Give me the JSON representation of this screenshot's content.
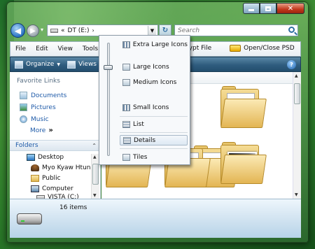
{
  "toolbar_nav": {
    "address_prefix": "«",
    "address_text": "DT (E:)",
    "address_sep": "›",
    "search_placeholder": "Search"
  },
  "menubar": {
    "items": [
      "File",
      "Edit",
      "View",
      "Tools"
    ],
    "encrypt_label": "crypt File",
    "open_close_label": "Open/Close PSD"
  },
  "commandbar": {
    "organize_label": "Organize",
    "views_label": "Views"
  },
  "favorites": {
    "header": "Favorite Links",
    "items": [
      "Documents",
      "Pictures",
      "Music"
    ],
    "more_label": "More",
    "more_chevron": "»"
  },
  "folders": {
    "header": "Folders",
    "tree": [
      "Desktop",
      "Myo Kyaw Htun",
      "Public",
      "Computer",
      "VISTA (C:)"
    ]
  },
  "views_menu": {
    "items": [
      {
        "label": "Extra Large Icons",
        "icon": "grid"
      },
      {
        "label": "Large Icons",
        "icon": "icon"
      },
      {
        "label": "Medium Icons",
        "icon": "icon"
      },
      {
        "label": "Small Icons",
        "icon": "grid"
      },
      {
        "label": "List",
        "icon": "list"
      },
      {
        "label": "Details",
        "icon": "list"
      },
      {
        "label": "Tiles",
        "icon": "icon"
      }
    ],
    "selected": "Details",
    "slider_level": "Large Icons"
  },
  "details_pane": {
    "item_count": "16 items"
  },
  "icons": {
    "caption": [
      "minimize-icon",
      "maximize-icon",
      "close-icon"
    ],
    "nav": [
      "back-arrow-icon",
      "forward-arrow-icon",
      "refresh-icon",
      "search-icon",
      "help-icon"
    ]
  },
  "colors": {
    "toolbar": "#2f5c7e",
    "link": "#1e5aa8",
    "close": "#c2371b"
  }
}
